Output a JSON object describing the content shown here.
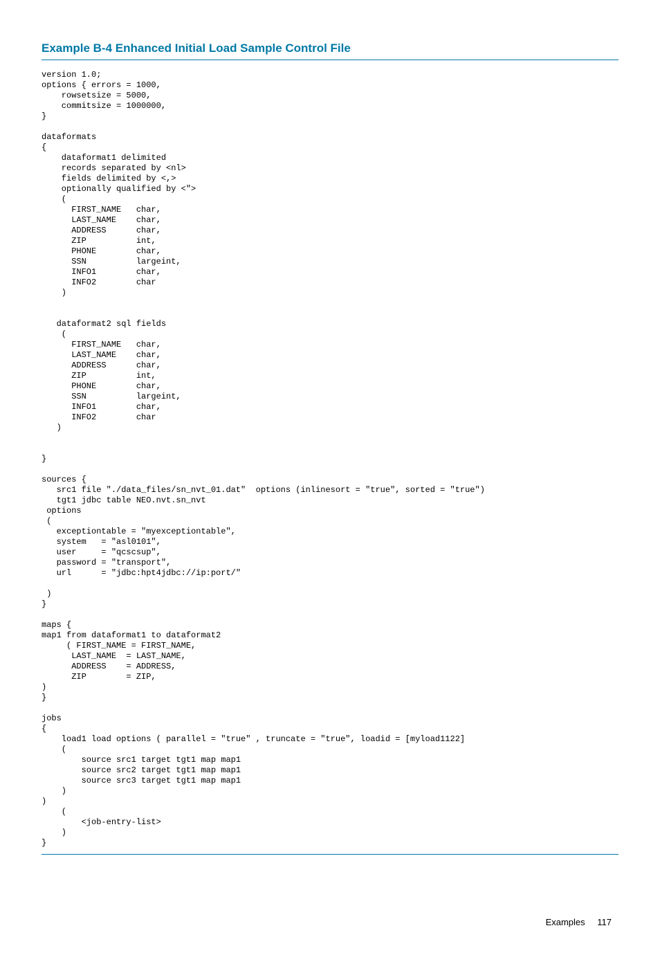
{
  "title": "Example B-4 Enhanced Initial Load Sample Control File",
  "code": "version 1.0;\noptions { errors = 1000,\n    rowsetsize = 5000,\n    commitsize = 1000000,\n}\n\ndataformats\n{\n    dataformat1 delimited\n    records separated by <nl>\n    fields delimited by <,>\n    optionally qualified by <\">\n    (\n      FIRST_NAME   char,\n      LAST_NAME    char,\n      ADDRESS      char,\n      ZIP          int,\n      PHONE        char,\n      SSN          largeint,\n      INFO1        char,\n      INFO2        char\n    )\n\n\n   dataformat2 sql fields\n    (\n      FIRST_NAME   char,\n      LAST_NAME    char,\n      ADDRESS      char,\n      ZIP          int,\n      PHONE        char,\n      SSN          largeint,\n      INFO1        char,\n      INFO2        char\n   )\n\n\n}\n\nsources {\n   src1 file \"./data_files/sn_nvt_01.dat\"  options (inlinesort = \"true\", sorted = \"true\")\n   tgt1 jdbc table NEO.nvt.sn_nvt\n options\n (\n   exceptiontable = \"myexceptiontable\",\n   system   = \"asl0101\",\n   user     = \"qcscsup\",\n   password = \"transport\",\n   url      = \"jdbc:hpt4jdbc://ip:port/\"\n\n )\n}\n\nmaps {\nmap1 from dataformat1 to dataformat2\n     ( FIRST_NAME = FIRST_NAME,\n      LAST_NAME  = LAST_NAME,\n      ADDRESS    = ADDRESS,\n      ZIP        = ZIP,\n)\n}\n\njobs\n{\n    load1 load options ( parallel = \"true\" , truncate = \"true\", loadid = [myload1122]\n    (\n        source src1 target tgt1 map map1\n        source src2 target tgt1 map map1\n        source src3 target tgt1 map map1\n    )\n)\n    (\n        <job-entry-list>\n    )\n}",
  "footer": {
    "label": "Examples",
    "page": "117"
  }
}
